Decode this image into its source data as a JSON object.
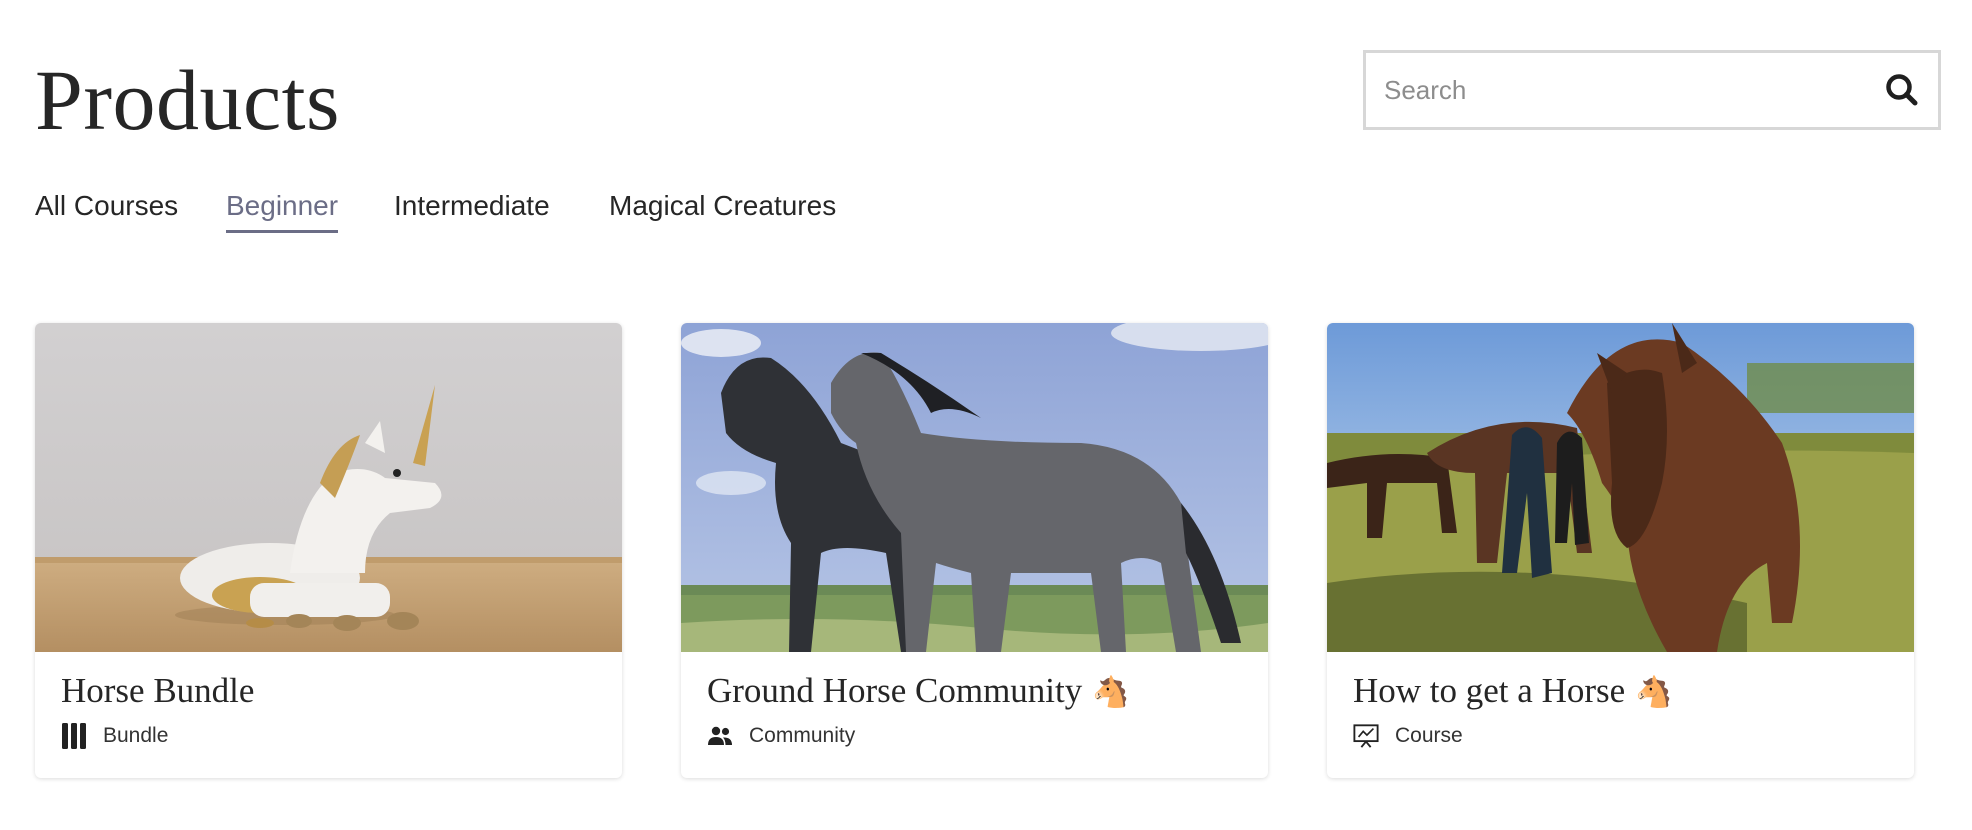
{
  "header": {
    "title": "Products"
  },
  "search": {
    "placeholder": "Search",
    "icon": "search-icon"
  },
  "tabs": [
    {
      "label": "All Courses",
      "active": false
    },
    {
      "label": "Beginner",
      "active": true
    },
    {
      "label": "Intermediate",
      "active": false
    },
    {
      "label": "Magical Creatures",
      "active": false
    }
  ],
  "colors": {
    "accent": "#6b6d86",
    "text": "#262626",
    "border": "#d7d7d7"
  },
  "products": [
    {
      "title": "Horse Bundle",
      "emoji": "",
      "type": "Bundle",
      "icon": "bundle-icon",
      "image": "unicorn-figurine-photo"
    },
    {
      "title": "Ground Horse Community",
      "emoji": "🐴",
      "type": "Community",
      "icon": "community-icon",
      "image": "two-grey-horses-photo"
    },
    {
      "title": "How to get a Horse",
      "emoji": "🐴",
      "type": "Course",
      "icon": "course-icon",
      "image": "horses-in-pasture-photo"
    }
  ]
}
